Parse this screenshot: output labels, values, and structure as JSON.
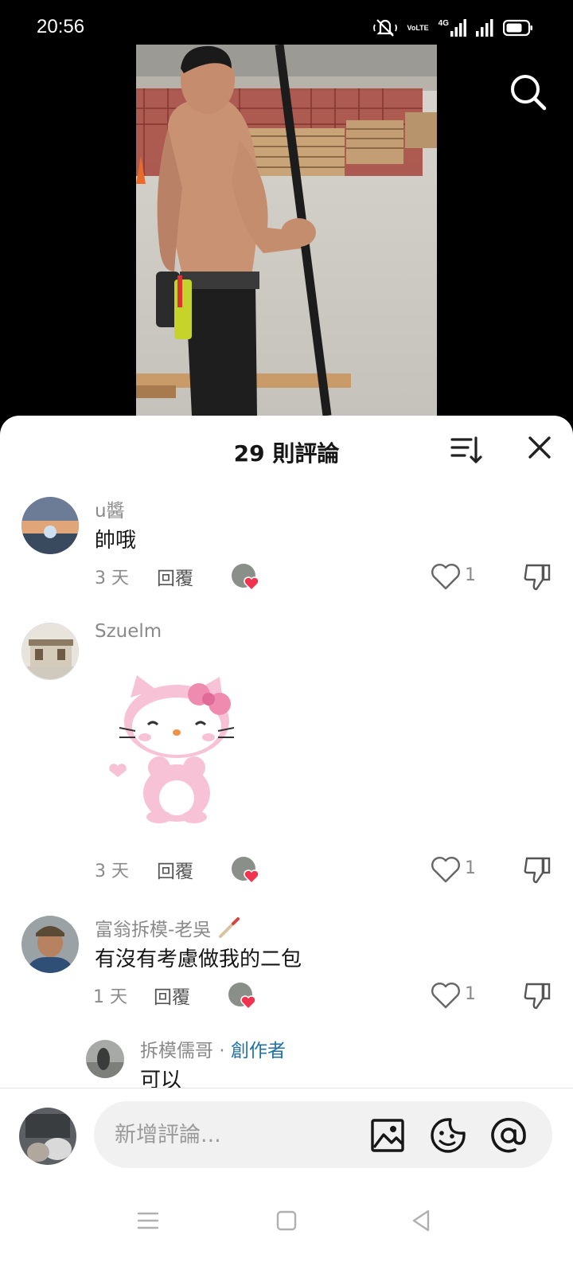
{
  "status_bar": {
    "time": "20:56",
    "network_text": "VoLTE",
    "signal_text": "4G",
    "icons": [
      "mute-icon",
      "volte-icon",
      "4g-signal-icon",
      "signal-icon",
      "battery-icon"
    ]
  },
  "video": {
    "icons": [
      "search-icon"
    ]
  },
  "sheet": {
    "title": "29 則評論",
    "sort_icon": "sort-icon",
    "close_icon": "close-icon"
  },
  "comments": [
    {
      "username": "u醬",
      "text": "帥哦",
      "age": "3 天",
      "reply_label": "回覆",
      "likes": "1"
    },
    {
      "username": "Szuelm",
      "text": "",
      "sticker": "hello-kitty-sticker",
      "age": "3 天",
      "reply_label": "回覆",
      "likes": "1"
    },
    {
      "username": "富翁拆模-老吳",
      "text": "有沒有考慮做我的二包",
      "age": "1 天",
      "reply_label": "回覆",
      "likes": "1"
    }
  ],
  "reply": {
    "username": "拆模儒哥",
    "separator": " · ",
    "badge": "創作者",
    "text": "可以"
  },
  "composer": {
    "placeholder": "新增評論...",
    "icons": [
      "image-icon",
      "sticker-icon",
      "mention-icon"
    ]
  },
  "nav": {
    "icons": [
      "menu-icon",
      "home-icon",
      "back-icon"
    ]
  },
  "colors": {
    "heart_red": "#f0334f",
    "creator_blue": "#1f6fa8",
    "sheet_bg": "#ffffff",
    "sticker_pink": "#f4a6c4"
  }
}
